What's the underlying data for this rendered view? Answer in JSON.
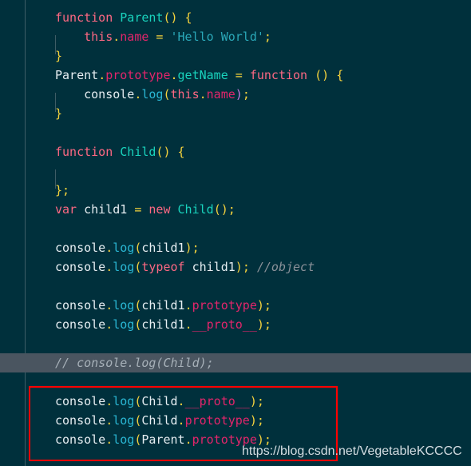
{
  "editor": {
    "background_color": "#00303c",
    "active_line_color": "#4a5560",
    "gutter_rule_color": "#3d5d66",
    "annotation_box_color": "#ff0000",
    "language": "javascript"
  },
  "watermark": {
    "text": "https://blog.csdn.net/VegetableKCCCC"
  },
  "code": {
    "lines": [
      {
        "index": 1,
        "text": "function Parent() {"
      },
      {
        "index": 2,
        "text": "    this.name = 'Hello World';"
      },
      {
        "index": 3,
        "text": "}"
      },
      {
        "index": 4,
        "text": "Parent.prototype.getName = function () {"
      },
      {
        "index": 5,
        "text": "    console.log(this.name);"
      },
      {
        "index": 6,
        "text": "}"
      },
      {
        "index": 7,
        "text": ""
      },
      {
        "index": 8,
        "text": "function Child() {"
      },
      {
        "index": 9,
        "text": ""
      },
      {
        "index": 10,
        "text": "};"
      },
      {
        "index": 11,
        "text": "var child1 = new Child();"
      },
      {
        "index": 12,
        "text": ""
      },
      {
        "index": 13,
        "text": "console.log(child1);"
      },
      {
        "index": 14,
        "text": "console.log(typeof child1); //object"
      },
      {
        "index": 15,
        "text": ""
      },
      {
        "index": 16,
        "text": "console.log(child1.prototype);"
      },
      {
        "index": 17,
        "text": "console.log(child1.__proto__);"
      },
      {
        "index": 18,
        "text": ""
      },
      {
        "index": 19,
        "text": "// console.log(Child);",
        "active": true
      },
      {
        "index": 20,
        "text": ""
      },
      {
        "index": 21,
        "text": "console.log(Child.__proto__);",
        "highlighted": true
      },
      {
        "index": 22,
        "text": "console.log(Child.prototype);",
        "highlighted": true
      },
      {
        "index": 23,
        "text": "console.log(Parent.prototype);",
        "highlighted": true
      }
    ],
    "tokens": {
      "l1_function": "function",
      "l1_name": "Parent",
      "l1_parens": "()",
      "l1_brace": " {",
      "l2_this": "this",
      "l2_dot": ".",
      "l2_name": "name",
      "l2_eq": " = ",
      "l2_string": "'Hello World'",
      "l2_semi": ";",
      "l3_brace": "}",
      "l4_parent": "Parent",
      "l4_dot1": ".",
      "l4_prototype": "prototype",
      "l4_dot2": ".",
      "l4_getname": "getName",
      "l4_eq": " = ",
      "l4_function": "function",
      "l4_parens": " ()",
      "l4_brace": " {",
      "l5_console": "console",
      "l5_dot1": ".",
      "l5_log": "log",
      "l5_lparen": "(",
      "l5_this": "this",
      "l5_dot2": ".",
      "l5_name": "name",
      "l5_rparen": ")",
      "l5_semi": ";",
      "l6_brace": "}",
      "l8_function": "function",
      "l8_name": "Child",
      "l8_parens": "()",
      "l8_brace": " {",
      "l10_close": "};",
      "l11_var": "var",
      "l11_ident": " child1",
      "l11_eq": " = ",
      "l11_new": "new",
      "l11_child": " Child",
      "l11_parens": "()",
      "l11_semi": ";",
      "l13_console": "console",
      "l13_dot": ".",
      "l13_log": "log",
      "l13_lparen": "(",
      "l13_arg": "child1",
      "l13_rparen": ")",
      "l13_semi": ";",
      "l14_console": "console",
      "l14_dot": ".",
      "l14_log": "log",
      "l14_lparen": "(",
      "l14_typeof": "typeof",
      "l14_arg": " child1",
      "l14_rparen": ")",
      "l14_semi": ";",
      "l14_comment": " //object",
      "l16_console": "console",
      "l16_dot": ".",
      "l16_log": "log",
      "l16_lparen": "(",
      "l16_obj": "child1",
      "l16_dot2": ".",
      "l16_prop": "prototype",
      "l16_rparen": ")",
      "l16_semi": ";",
      "l17_console": "console",
      "l17_dot": ".",
      "l17_log": "log",
      "l17_lparen": "(",
      "l17_obj": "child1",
      "l17_dot2": ".",
      "l17_prop": "__proto__",
      "l17_rparen": ")",
      "l17_semi": ";",
      "l19_comment": "// console.log(Child);",
      "l21_console": "console",
      "l21_dot": ".",
      "l21_log": "log",
      "l21_lparen": "(",
      "l21_obj": "Child",
      "l21_dot2": ".",
      "l21_prop": "__proto__",
      "l21_rparen": ")",
      "l21_semi": ";",
      "l22_console": "console",
      "l22_dot": ".",
      "l22_log": "log",
      "l22_lparen": "(",
      "l22_obj": "Child",
      "l22_dot2": ".",
      "l22_prop": "prototype",
      "l22_rparen": ")",
      "l22_semi": ";",
      "l23_console": "console",
      "l23_dot": ".",
      "l23_log": "log",
      "l23_lparen": "(",
      "l23_obj": "Parent",
      "l23_dot2": ".",
      "l23_prop": "prototype",
      "l23_rparen": ")",
      "l23_semi": ";"
    }
  }
}
